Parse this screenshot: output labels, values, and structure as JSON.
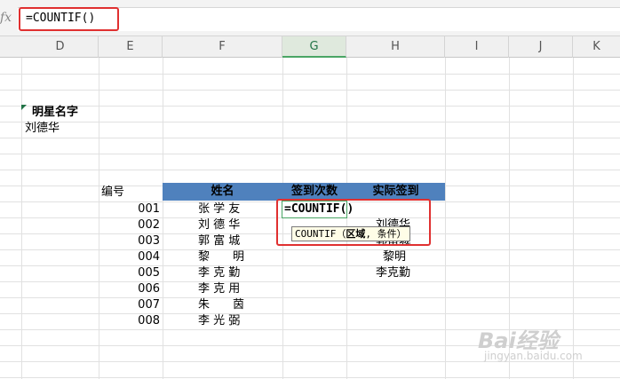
{
  "formula_bar": {
    "fx_label": "fx",
    "value": "=COUNTIF()"
  },
  "columns": [
    "D",
    "E",
    "F",
    "G",
    "H",
    "I",
    "J",
    "K"
  ],
  "cells": {
    "star_name_header": "明星名字",
    "star_name_value": "刘德华",
    "index_label": "编号",
    "table_headers": {
      "name": "姓名",
      "sign_count": "签到次数",
      "actual_sign": "实际签到"
    },
    "rows": [
      {
        "id": "001",
        "name": "张 学 友"
      },
      {
        "id": "002",
        "name": "刘 德 华"
      },
      {
        "id": "003",
        "name": "郭 富 城"
      },
      {
        "id": "004",
        "name": "黎　　明"
      },
      {
        "id": "005",
        "name": "李 克 勤"
      },
      {
        "id": "006",
        "name": "李 克 用"
      },
      {
        "id": "007",
        "name": "朱　　茵"
      },
      {
        "id": "008",
        "name": "李 光 弼"
      }
    ],
    "actual_sign_values": [
      "刘德华",
      "郭富城",
      "黎明",
      "李克勤"
    ]
  },
  "editing_cell": {
    "value": "=COUNTIF()"
  },
  "tooltip": {
    "func": "COUNTIF",
    "open": "（",
    "arg1": "区域",
    "sep": ", ",
    "arg2": "条件",
    "close": "）"
  },
  "watermark": {
    "brand": "Bai经验",
    "url": "jingyan.baidu.com"
  },
  "colors": {
    "header_fill": "#4f81bd",
    "highlight": "#e03030",
    "selection": "#4aa564"
  }
}
